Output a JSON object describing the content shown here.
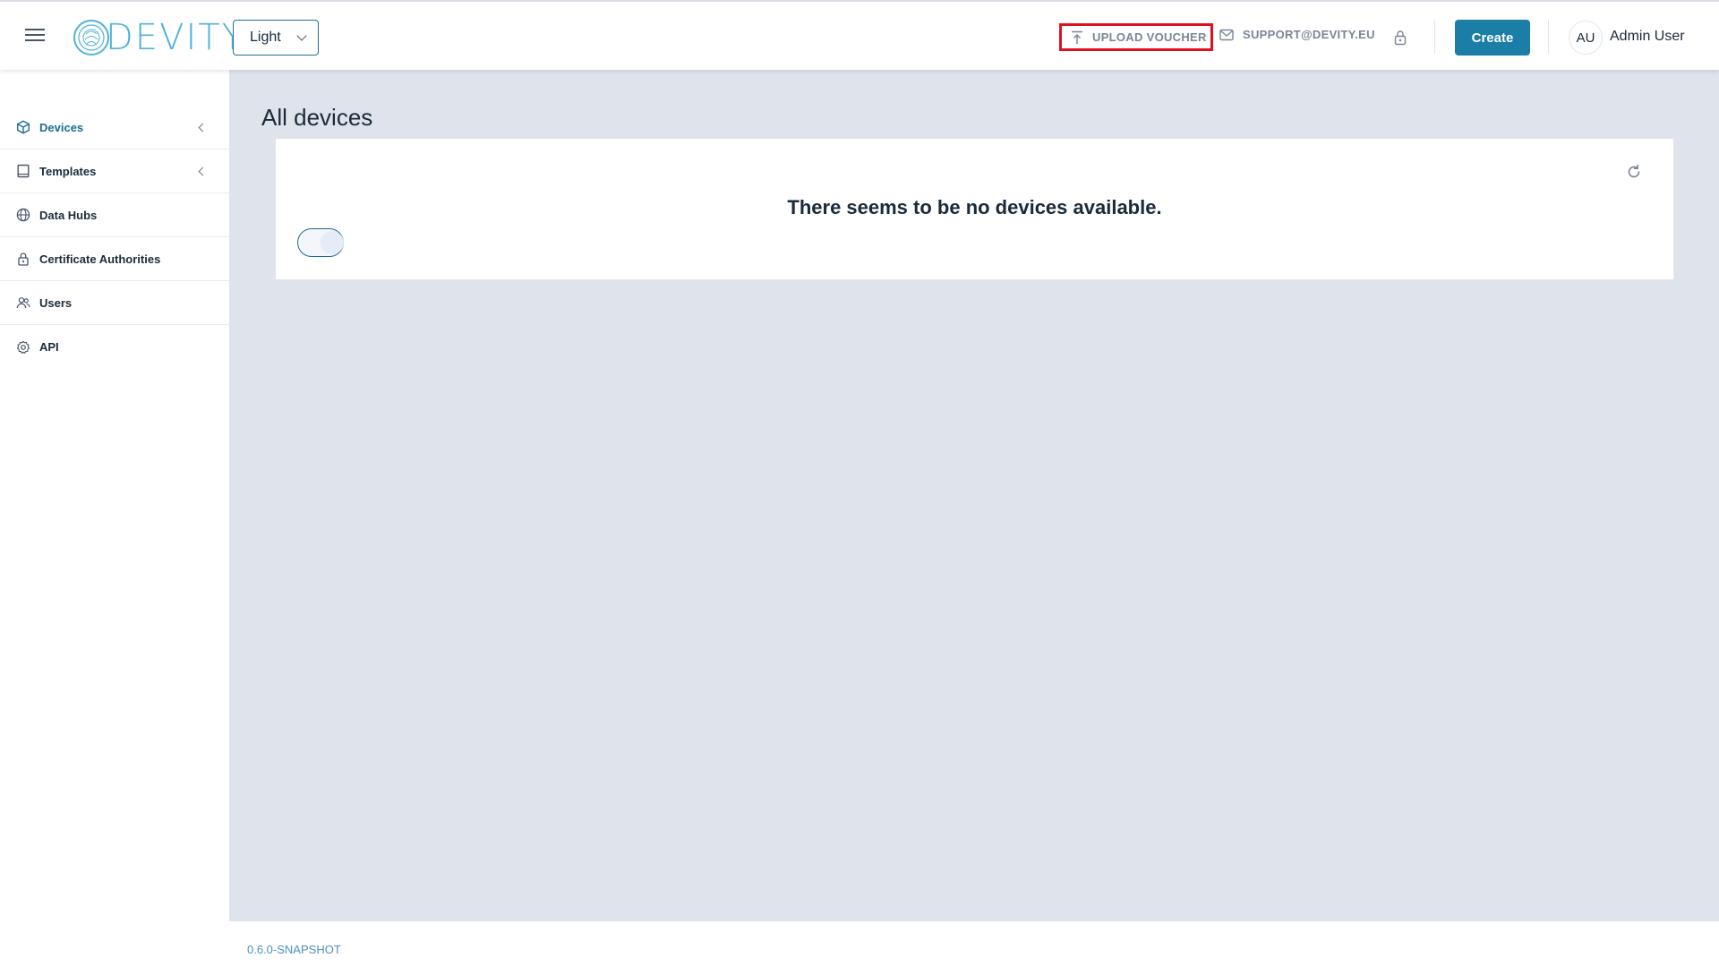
{
  "header": {
    "brand": "DEVITY",
    "theme": {
      "selected": "Light"
    },
    "upload_voucher_label": "UPLOAD VOUCHER",
    "support_label": "SUPPORT@DEVITY.EU",
    "create_label": "Create",
    "user": {
      "initials": "AU",
      "name": "Admin User"
    }
  },
  "sidebar": {
    "items": [
      {
        "label": "Devices",
        "icon": "cube-icon",
        "active": true,
        "expandable": true
      },
      {
        "label": "Templates",
        "icon": "book-icon",
        "active": false,
        "expandable": true
      },
      {
        "label": "Data Hubs",
        "icon": "globe-icon",
        "active": false,
        "expandable": false
      },
      {
        "label": "Certificate Authorities",
        "icon": "lock-icon",
        "active": false,
        "expandable": false
      },
      {
        "label": "Users",
        "icon": "users-icon",
        "active": false,
        "expandable": false
      },
      {
        "label": "API",
        "icon": "gear-icon",
        "active": false,
        "expandable": false
      }
    ]
  },
  "main": {
    "title": "All devices",
    "empty_message": "There seems to be no devices available."
  },
  "footer": {
    "version": "0.6.0-SNAPSHOT"
  },
  "colors": {
    "accent": "#1a7ea6",
    "highlight": "#e0111f",
    "background": "#dfe3eb"
  }
}
